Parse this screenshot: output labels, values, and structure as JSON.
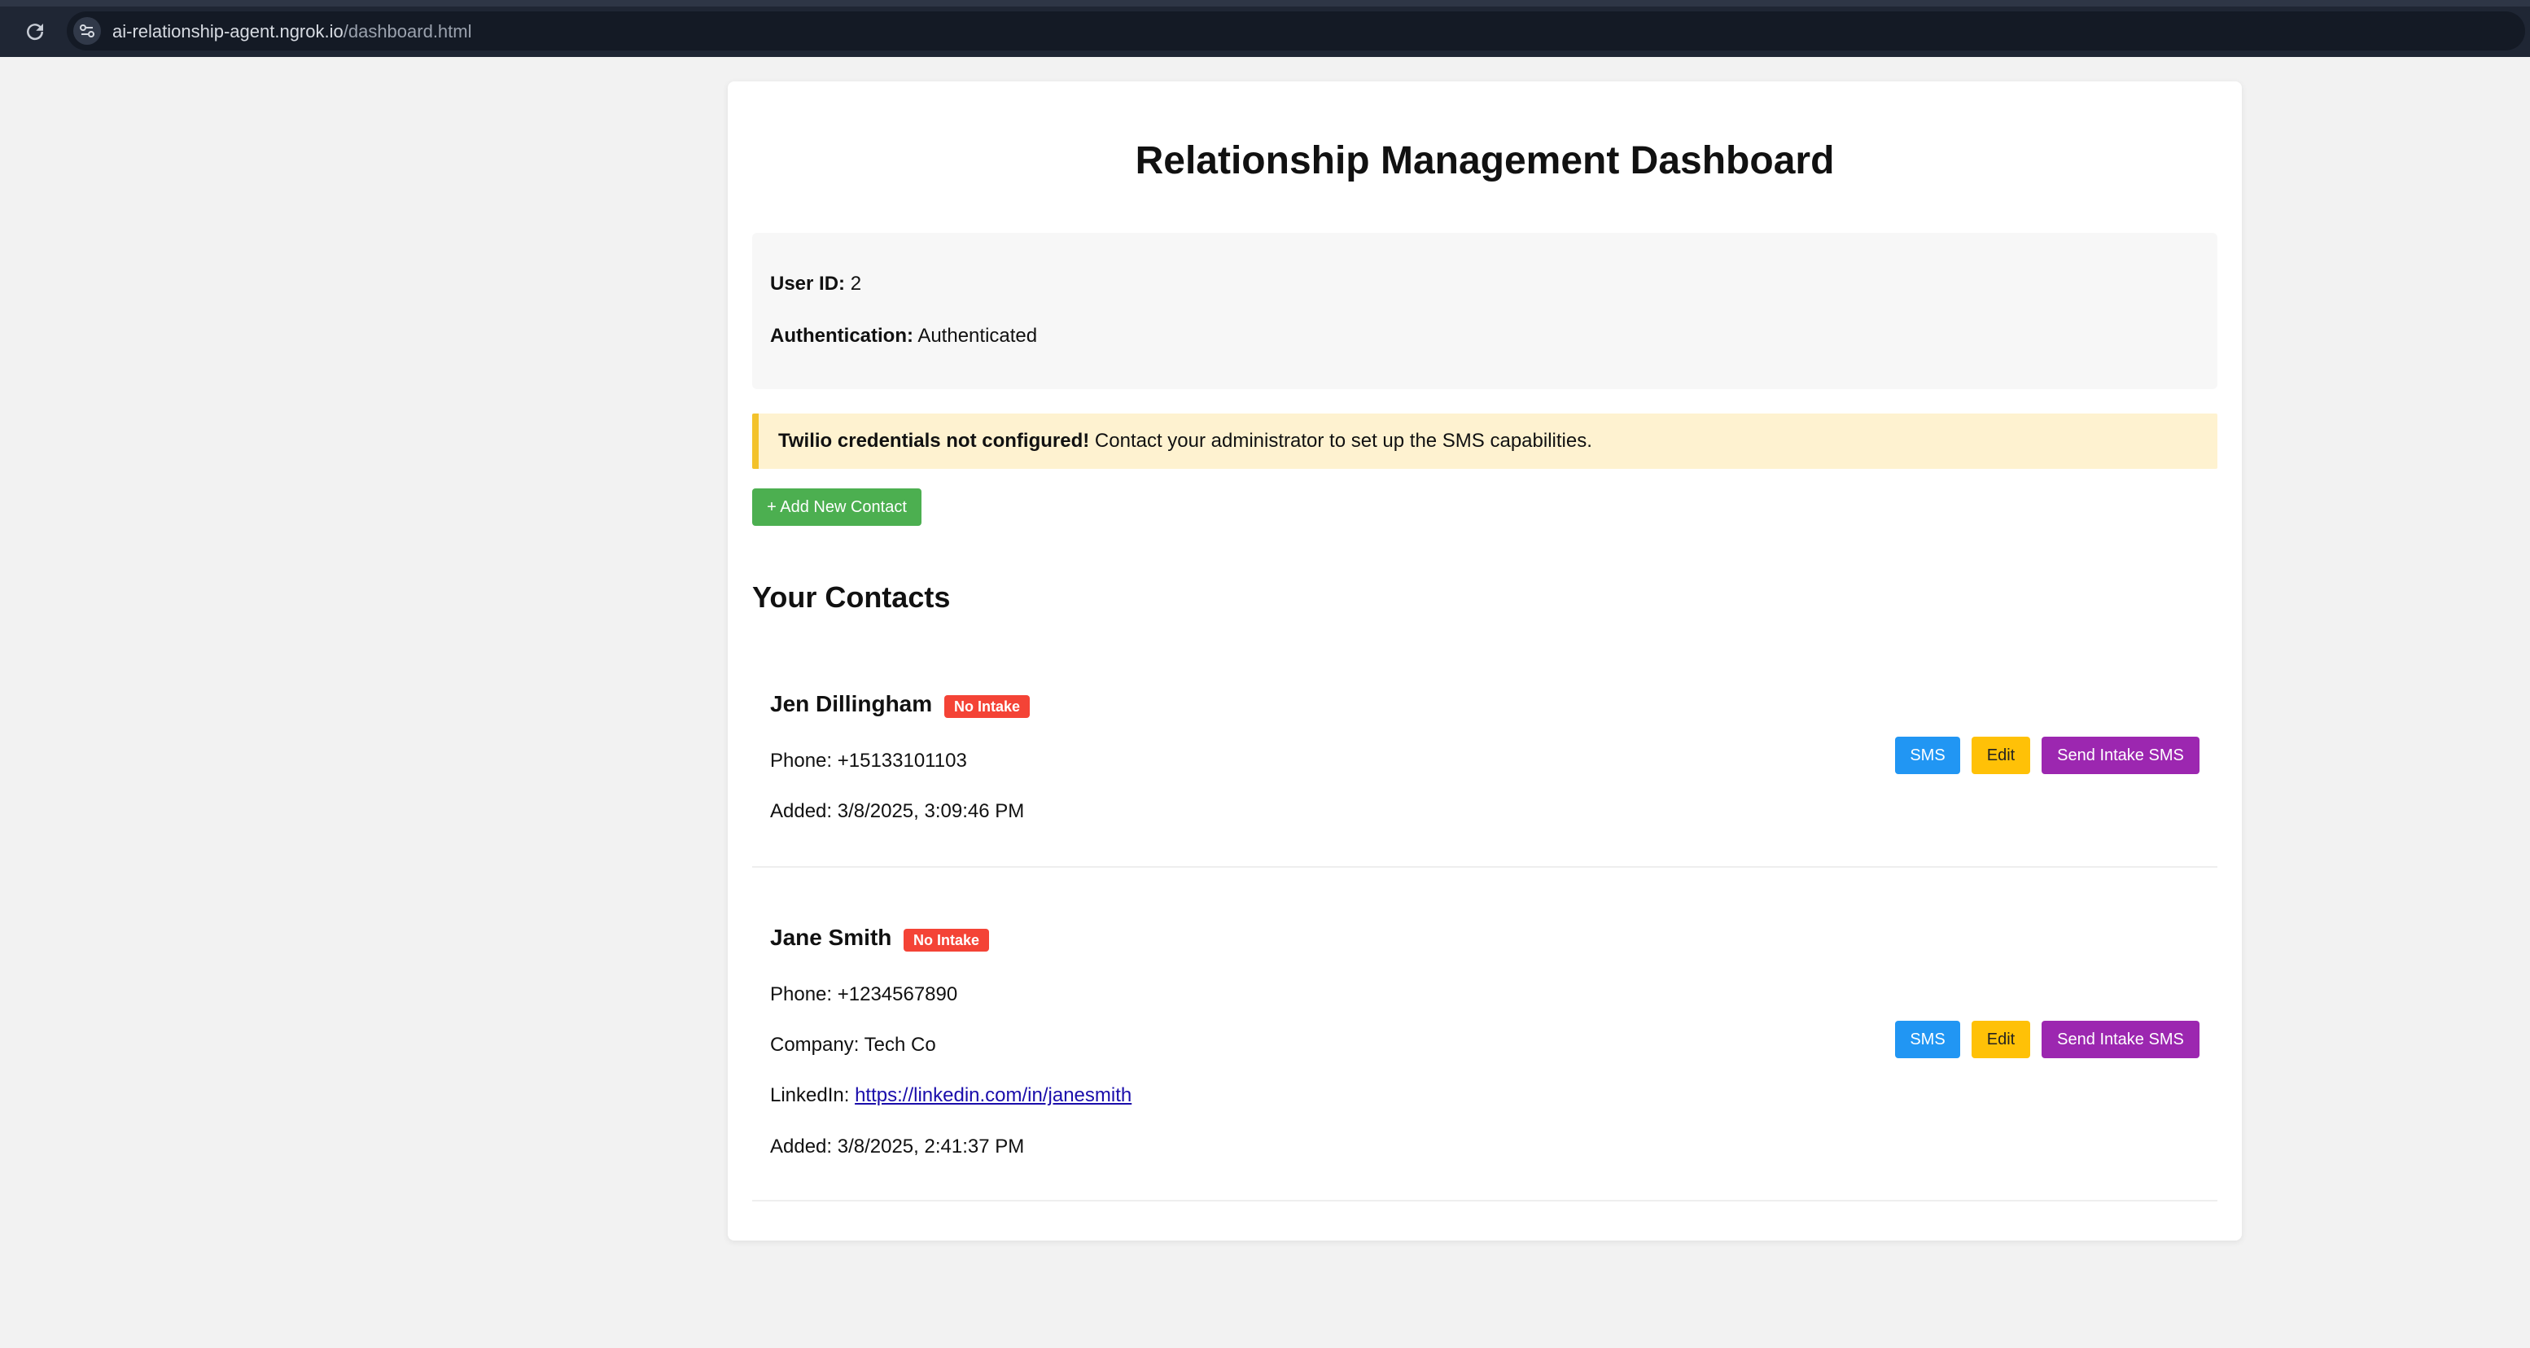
{
  "browser": {
    "url_host": "ai-relationship-agent.ngrok.io",
    "url_path": "/dashboard.html"
  },
  "page": {
    "title": "Relationship Management Dashboard"
  },
  "user_info": {
    "user_id_label": "User ID:",
    "user_id_value": "2",
    "auth_label": "Authentication:",
    "auth_value": "Authenticated"
  },
  "alert": {
    "strong": "Twilio credentials not configured!",
    "text": "Contact your administrator to set up the SMS capabilities."
  },
  "add_contact_label": "+ Add New Contact",
  "contacts_title": "Your Contacts",
  "contacts": [
    {
      "name": "Jen Dillingham",
      "badge": "No Intake",
      "phone": "Phone: +15133101103",
      "added": "Added: 3/8/2025, 3:09:46 PM"
    },
    {
      "name": "Jane Smith",
      "badge": "No Intake",
      "phone": "Phone: +1234567890",
      "company": "Company: Tech Co",
      "linkedin_label": "LinkedIn:",
      "linkedin_url": "https://linkedin.com/in/janesmith",
      "added": "Added: 3/8/2025, 2:41:37 PM"
    }
  ],
  "actions": {
    "sms_label": "SMS",
    "edit_label": "Edit",
    "intake_label": "Send Intake SMS"
  },
  "colors": {
    "add": "#4caf50",
    "sms": "#2196f3",
    "edit": "#ffc107",
    "intake": "#9c27b0",
    "badge": "#f44336",
    "alert_bg": "#fef2d0",
    "alert_border": "#f3c22b"
  }
}
